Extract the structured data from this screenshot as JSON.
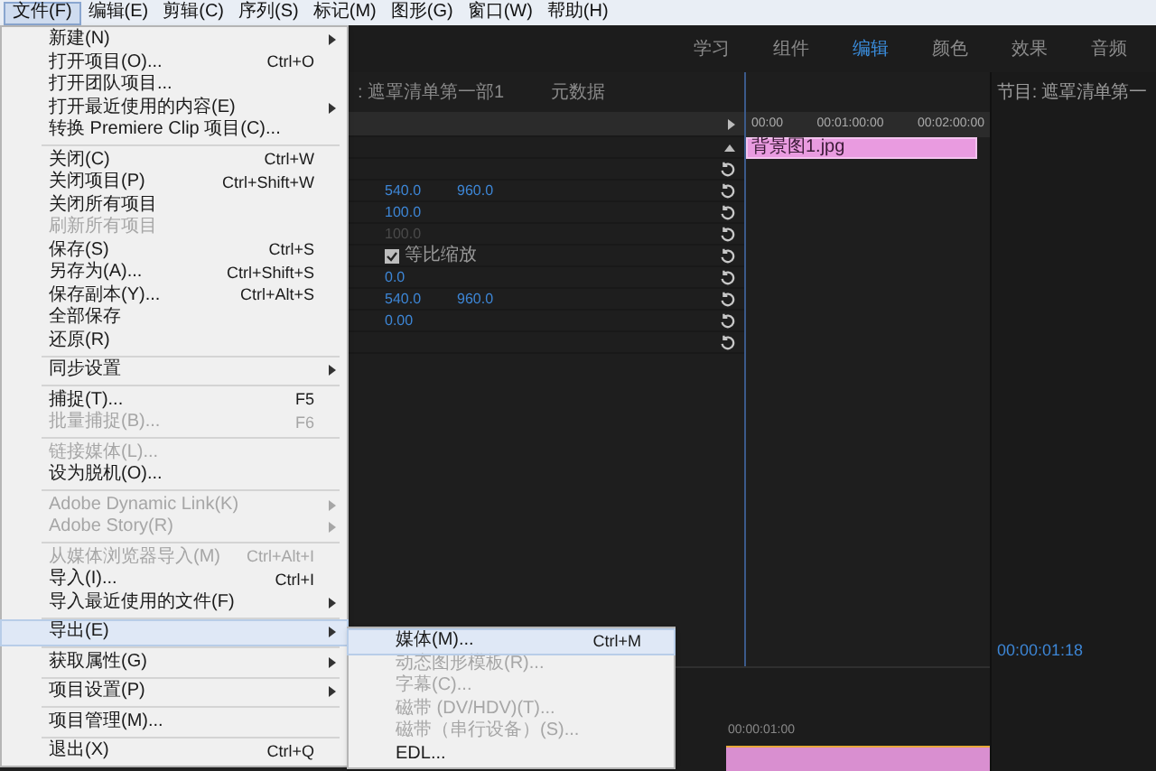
{
  "menubar": [
    {
      "label": "文件(F)",
      "selected": true
    },
    {
      "label": "编辑(E)",
      "selected": false
    },
    {
      "label": "剪辑(C)",
      "selected": false
    },
    {
      "label": "序列(S)",
      "selected": false
    },
    {
      "label": "标记(M)",
      "selected": false
    },
    {
      "label": "图形(G)",
      "selected": false
    },
    {
      "label": "窗口(W)",
      "selected": false
    },
    {
      "label": "帮助(H)",
      "selected": false
    }
  ],
  "workspace_tabs": [
    {
      "label": "学习",
      "selected": false
    },
    {
      "label": "组件",
      "selected": false
    },
    {
      "label": "编辑",
      "selected": true
    },
    {
      "label": "颜色",
      "selected": false
    },
    {
      "label": "效果",
      "selected": false
    },
    {
      "label": "音频",
      "selected": false
    }
  ],
  "panel_tabs": [
    {
      "label": ": 遮罩清单第一部1"
    },
    {
      "label": "元数据"
    }
  ],
  "effect_controls": {
    "rows": [
      {
        "kind": "header"
      },
      {
        "kind": "blank"
      },
      {
        "kind": "blank"
      },
      {
        "kind": "values",
        "values": [
          "540.0",
          "960.0"
        ],
        "disabled": false
      },
      {
        "kind": "values",
        "values": [
          "100.0"
        ],
        "disabled": false
      },
      {
        "kind": "values",
        "values": [
          "100.0"
        ],
        "disabled": true
      },
      {
        "kind": "checkbox",
        "label": "等比缩放",
        "checked": true
      },
      {
        "kind": "values",
        "values": [
          "0.0"
        ],
        "disabled": false
      },
      {
        "kind": "values",
        "values": [
          "540.0",
          "960.0"
        ],
        "disabled": false
      },
      {
        "kind": "values",
        "values": [
          "0.00"
        ],
        "disabled": false
      },
      {
        "kind": "blank"
      }
    ]
  },
  "mini_timeline": {
    "ruler": [
      "00:00",
      "00:01:00:00",
      "00:02:00:00"
    ],
    "clip": "背景图1.jpg"
  },
  "program_monitor": {
    "title": "节目: 遮罩清单第一",
    "timecode": "00:00:01:18"
  },
  "timeline": {
    "ruler": "00:00:01:00"
  },
  "file_menu": {
    "items": [
      {
        "kind": "item",
        "label": "新建(N)",
        "submenu": true,
        "disabled": false,
        "selected": false
      },
      {
        "kind": "item",
        "label": "打开项目(O)...",
        "shortcut": "Ctrl+O",
        "submenu": false,
        "disabled": false,
        "selected": false
      },
      {
        "kind": "item",
        "label": "打开团队项目...",
        "submenu": false,
        "disabled": false,
        "selected": false
      },
      {
        "kind": "item",
        "label": "打开最近使用的内容(E)",
        "submenu": true,
        "disabled": false,
        "selected": false
      },
      {
        "kind": "item",
        "label": "转换 Premiere Clip 项目(C)...",
        "submenu": false,
        "disabled": false,
        "selected": false
      },
      {
        "kind": "separator"
      },
      {
        "kind": "item",
        "label": "关闭(C)",
        "shortcut": "Ctrl+W",
        "submenu": false,
        "disabled": false,
        "selected": false
      },
      {
        "kind": "item",
        "label": "关闭项目(P)",
        "shortcut": "Ctrl+Shift+W",
        "submenu": false,
        "disabled": false,
        "selected": false
      },
      {
        "kind": "item",
        "label": "关闭所有项目",
        "submenu": false,
        "disabled": false,
        "selected": false
      },
      {
        "kind": "item",
        "label": "刷新所有项目",
        "submenu": false,
        "disabled": true,
        "selected": false
      },
      {
        "kind": "item",
        "label": "保存(S)",
        "shortcut": "Ctrl+S",
        "submenu": false,
        "disabled": false,
        "selected": false
      },
      {
        "kind": "item",
        "label": "另存为(A)...",
        "shortcut": "Ctrl+Shift+S",
        "submenu": false,
        "disabled": false,
        "selected": false
      },
      {
        "kind": "item",
        "label": "保存副本(Y)...",
        "shortcut": "Ctrl+Alt+S",
        "submenu": false,
        "disabled": false,
        "selected": false
      },
      {
        "kind": "item",
        "label": "全部保存",
        "submenu": false,
        "disabled": false,
        "selected": false
      },
      {
        "kind": "item",
        "label": "还原(R)",
        "submenu": false,
        "disabled": false,
        "selected": false
      },
      {
        "kind": "separator"
      },
      {
        "kind": "item",
        "label": "同步设置",
        "submenu": true,
        "disabled": false,
        "selected": false
      },
      {
        "kind": "separator"
      },
      {
        "kind": "item",
        "label": "捕捉(T)...",
        "shortcut": "F5",
        "submenu": false,
        "disabled": false,
        "selected": false
      },
      {
        "kind": "item",
        "label": "批量捕捉(B)...",
        "shortcut": "F6",
        "submenu": false,
        "disabled": true,
        "selected": false
      },
      {
        "kind": "separator"
      },
      {
        "kind": "item",
        "label": "链接媒体(L)...",
        "submenu": false,
        "disabled": true,
        "selected": false
      },
      {
        "kind": "item",
        "label": "设为脱机(O)...",
        "submenu": false,
        "disabled": false,
        "selected": false
      },
      {
        "kind": "separator"
      },
      {
        "kind": "item",
        "label": "Adobe Dynamic Link(K)",
        "submenu": true,
        "disabled": true,
        "selected": false
      },
      {
        "kind": "item",
        "label": "Adobe Story(R)",
        "submenu": true,
        "disabled": true,
        "selected": false
      },
      {
        "kind": "separator"
      },
      {
        "kind": "item",
        "label": "从媒体浏览器导入(M)",
        "shortcut": "Ctrl+Alt+I",
        "submenu": false,
        "disabled": true,
        "selected": false
      },
      {
        "kind": "item",
        "label": "导入(I)...",
        "shortcut": "Ctrl+I",
        "submenu": false,
        "disabled": false,
        "selected": false
      },
      {
        "kind": "item",
        "label": "导入最近使用的文件(F)",
        "submenu": true,
        "disabled": false,
        "selected": false
      },
      {
        "kind": "separator"
      },
      {
        "kind": "item",
        "label": "导出(E)",
        "submenu": true,
        "disabled": false,
        "selected": true
      },
      {
        "kind": "separator"
      },
      {
        "kind": "item",
        "label": "获取属性(G)",
        "submenu": true,
        "disabled": false,
        "selected": false
      },
      {
        "kind": "separator"
      },
      {
        "kind": "item",
        "label": "项目设置(P)",
        "submenu": true,
        "disabled": false,
        "selected": false
      },
      {
        "kind": "separator"
      },
      {
        "kind": "item",
        "label": "项目管理(M)...",
        "submenu": false,
        "disabled": false,
        "selected": false
      },
      {
        "kind": "separator"
      },
      {
        "kind": "item",
        "label": "退出(X)",
        "shortcut": "Ctrl+Q",
        "submenu": false,
        "disabled": false,
        "selected": false
      }
    ]
  },
  "export_submenu": {
    "items": [
      {
        "kind": "item",
        "label": "媒体(M)...",
        "shortcut": "Ctrl+M",
        "submenu": false,
        "disabled": false,
        "selected": true
      },
      {
        "kind": "item",
        "label": "动态图形模板(R)...",
        "submenu": false,
        "disabled": true,
        "selected": false
      },
      {
        "kind": "item",
        "label": "字幕(C)...",
        "submenu": false,
        "disabled": true,
        "selected": false
      },
      {
        "kind": "item",
        "label": "磁带 (DV/HDV)(T)...",
        "submenu": false,
        "disabled": true,
        "selected": false
      },
      {
        "kind": "item",
        "label": "磁带（串行设备）(S)...",
        "submenu": false,
        "disabled": true,
        "selected": false
      },
      {
        "kind": "item",
        "label": "EDL...",
        "submenu": false,
        "disabled": false,
        "selected": false
      }
    ]
  }
}
